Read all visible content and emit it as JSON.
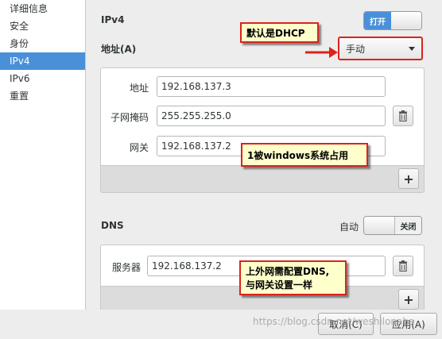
{
  "sidebar": {
    "items": [
      {
        "label": "详细信息"
      },
      {
        "label": "安全"
      },
      {
        "label": "身份"
      },
      {
        "label": "IPv4"
      },
      {
        "label": "IPv6"
      },
      {
        "label": "重置"
      }
    ],
    "active_index": 3
  },
  "ipv4": {
    "title": "IPv4",
    "toggle_label": "打开",
    "toggle_state": "on",
    "address_section_label": "地址(A)",
    "method_value": "手动",
    "fields": {
      "address_label": "地址",
      "address_value": "192.168.137.3",
      "netmask_label": "子网掩码",
      "netmask_value": "255.255.255.0",
      "gateway_label": "网关",
      "gateway_value": "192.168.137.2"
    },
    "add_label": "+"
  },
  "dns": {
    "title": "DNS",
    "auto_label": "自动",
    "toggle_label": "关闭",
    "toggle_state": "off",
    "server_label": "服务器",
    "server_value": "192.168.137.2",
    "add_label": "+"
  },
  "annotations": {
    "dhcp_note": "默认是DHCP",
    "gateway_note": "1被windows系统占用",
    "dns_note_line1": "上外网需配置DNS,",
    "dns_note_line2": "与网关设置一样"
  },
  "buttons": {
    "cancel": "取消(C)",
    "apply": "应用(A)"
  },
  "watermark": "https://blog.csdn.net/weshilonaba",
  "icons": {
    "delete": "trash-icon",
    "add": "plus-icon",
    "dropdown": "chevron-down-icon",
    "arrow": "arrow-right-icon"
  },
  "colors": {
    "accent": "#4a90d9",
    "callout_border": "#d9241c",
    "callout_bg": "#ffffcc"
  }
}
